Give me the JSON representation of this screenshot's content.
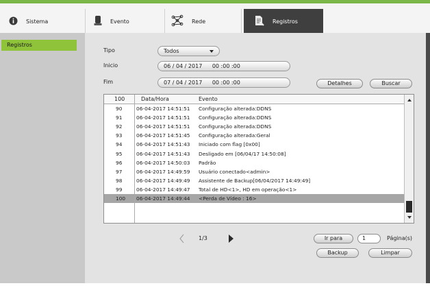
{
  "tabs": [
    {
      "label": "Sistema",
      "icon": "info-icon"
    },
    {
      "label": "Evento",
      "icon": "alarm-icon"
    },
    {
      "label": "Rede",
      "icon": "network-icon"
    },
    {
      "label": "Registros",
      "icon": "document-icon"
    }
  ],
  "sidebar": {
    "items": [
      {
        "label": "Registros"
      }
    ]
  },
  "form": {
    "tipo_label": "Tipo",
    "tipo_value": "Todos",
    "inicio_label": "Inicio",
    "inicio_date": "06 / 04 / 2017",
    "inicio_time": "00 :00 :00",
    "fim_label": "Fim",
    "fim_date": "07 / 04 / 2017",
    "fim_time": "00 :00 :00",
    "detalhes": "Detalhes",
    "buscar": "Buscar"
  },
  "table": {
    "count": "100",
    "headers": {
      "datahora": "Data/Hora",
      "evento": "Evento"
    },
    "rows": [
      {
        "n": "90",
        "dt": "06-04-2017 14:51:51",
        "ev": "Configuração alterada:DDNS"
      },
      {
        "n": "91",
        "dt": "06-04-2017 14:51:51",
        "ev": "Configuração alterada:DDNS"
      },
      {
        "n": "92",
        "dt": "06-04-2017 14:51:51",
        "ev": "Configuração alterada:DDNS"
      },
      {
        "n": "93",
        "dt": "06-04-2017 14:51:45",
        "ev": "Configuração alterada:Geral"
      },
      {
        "n": "94",
        "dt": "06-04-2017 14:51:43",
        "ev": "Iniciado com flag [0x00]"
      },
      {
        "n": "95",
        "dt": "06-04-2017 14:51:43",
        "ev": "Desligado em [06/04/17 14:50:08]"
      },
      {
        "n": "96",
        "dt": "06-04-2017 14:50:03",
        "ev": "Padrão"
      },
      {
        "n": "97",
        "dt": "06-04-2017 14:49:59",
        "ev": "Usuário conectado<admin>"
      },
      {
        "n": "98",
        "dt": "06-04-2017 14:49:49",
        "ev": "Assistente de Backup[06/04/2017 14:49:49]"
      },
      {
        "n": "99",
        "dt": "06-04-2017 14:49:47",
        "ev": "Total de HD<1>, HD em operação<1>"
      },
      {
        "n": "100",
        "dt": "06-04-2017 14:49:44",
        "ev": "<Perda de Vídeo : 16>"
      }
    ]
  },
  "pager": {
    "current": "1/3",
    "goto_label": "Ir para",
    "goto_value": "1",
    "pages_label": "Página(s)",
    "backup": "Backup",
    "limpar": "Limpar"
  },
  "colors": {
    "accent": "#8fc33a",
    "active_tab": "#3f3f3f",
    "selected_row": "#a6a6a6"
  }
}
